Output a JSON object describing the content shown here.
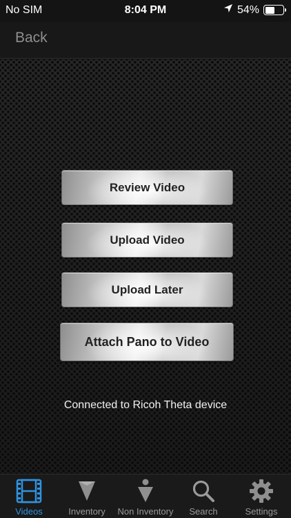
{
  "status_bar": {
    "carrier": "No SIM",
    "time": "8:04 PM",
    "battery_percent": "54%",
    "battery_level": 0.54,
    "icons": [
      "location-arrow-icon",
      "battery-icon"
    ]
  },
  "nav": {
    "back_label": "Back"
  },
  "actions": {
    "review": "Review Video",
    "upload": "Upload Video",
    "upload_later": "Upload Later",
    "attach_pano": "Attach Pano to Video"
  },
  "connection_status": "Connected to Ricoh Theta device",
  "tabs": [
    {
      "label": "Videos",
      "icon": "film-icon",
      "active": true
    },
    {
      "label": "Inventory",
      "icon": "inventory-icon",
      "active": false
    },
    {
      "label": "Non Inventory",
      "icon": "non-inventory-icon",
      "active": false
    },
    {
      "label": "Search",
      "icon": "search-icon",
      "active": false
    },
    {
      "label": "Settings",
      "icon": "gear-icon",
      "active": false
    }
  ],
  "colors": {
    "accent": "#2f93e0",
    "tab_inactive": "#9a9a9a",
    "background": "#1e1e1e"
  }
}
